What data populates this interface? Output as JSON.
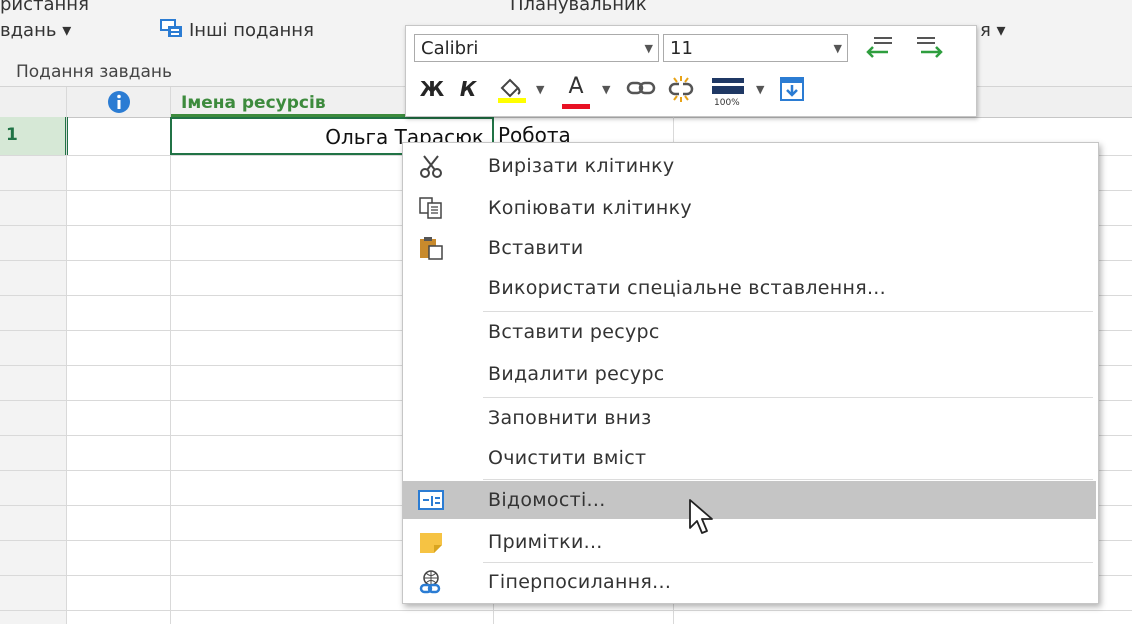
{
  "ribbon": {
    "left_top": "ристання",
    "left_mid": "вдань",
    "other_views": "Інші подання",
    "planner": "Планувальник",
    "right_partial": "я",
    "group_label": "Подання завдань"
  },
  "grid": {
    "col_resource_names": "Імена ресурсів",
    "row_number": "1",
    "resource_name": "Ольга Тарасюк",
    "type": "Робота"
  },
  "mini_toolbar": {
    "font_name": "Calibri",
    "font_size": "11",
    "bold_label": "Ж",
    "italic_label": "К",
    "font_color_letter": "A",
    "percent_label": "100%"
  },
  "context_menu": {
    "items": [
      {
        "label": "Вирізати клітинку",
        "icon": "scissors-icon"
      },
      {
        "label": "Копіювати клітинку",
        "icon": "copy-icon"
      },
      {
        "label": "Вставити",
        "icon": "paste-icon"
      },
      {
        "label": "Використати спеціальне вставлення...",
        "icon": ""
      },
      {
        "label": "Вставити ресурс",
        "icon": ""
      },
      {
        "label": "Видалити ресурс",
        "icon": ""
      },
      {
        "label": "Заповнити вниз",
        "icon": ""
      },
      {
        "label": "Очистити вміст",
        "icon": ""
      },
      {
        "label": "Відомості...",
        "icon": "information-form-icon",
        "highlighted": true
      },
      {
        "label": "Примітки...",
        "icon": "notes-icon"
      },
      {
        "label": "Гіперпосилання...",
        "icon": "hyperlink-icon"
      }
    ]
  },
  "colors": {
    "accent_green": "#217346",
    "header_green": "#3d8b3d",
    "highlight": "#c5c5c5",
    "info_blue": "#2b7cd3"
  }
}
